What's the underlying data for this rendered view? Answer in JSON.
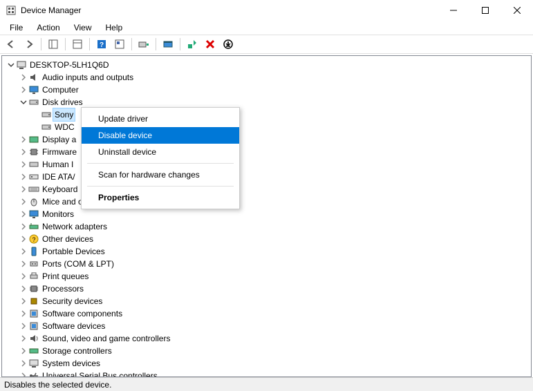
{
  "window": {
    "title": "Device Manager"
  },
  "menubar": {
    "file": "File",
    "action": "Action",
    "view": "View",
    "help": "Help"
  },
  "root": {
    "label": "DESKTOP-5LH1Q6D"
  },
  "categories": {
    "audio": "Audio inputs and outputs",
    "computer": "Computer",
    "disk": "Disk drives",
    "disk_child1": "Sony",
    "disk_child2": "WDC",
    "display": "Display a",
    "firmware": "Firmware",
    "hid": "Human I",
    "ide": "IDE ATA/",
    "keyboard": "Keyboard",
    "mice": "Mice and other pointing devices",
    "monitors": "Monitors",
    "network": "Network adapters",
    "other": "Other devices",
    "portable": "Portable Devices",
    "ports": "Ports (COM & LPT)",
    "printq": "Print queues",
    "processors": "Processors",
    "security": "Security devices",
    "softcomp": "Software components",
    "softdev": "Software devices",
    "sound": "Sound, video and game controllers",
    "storage": "Storage controllers",
    "system": "System devices",
    "usb": "Universal Serial Bus controllers"
  },
  "context_menu": {
    "update": "Update driver",
    "disable": "Disable device",
    "uninstall": "Uninstall device",
    "scan": "Scan for hardware changes",
    "properties": "Properties"
  },
  "statusbar": {
    "text": "Disables the selected device."
  }
}
